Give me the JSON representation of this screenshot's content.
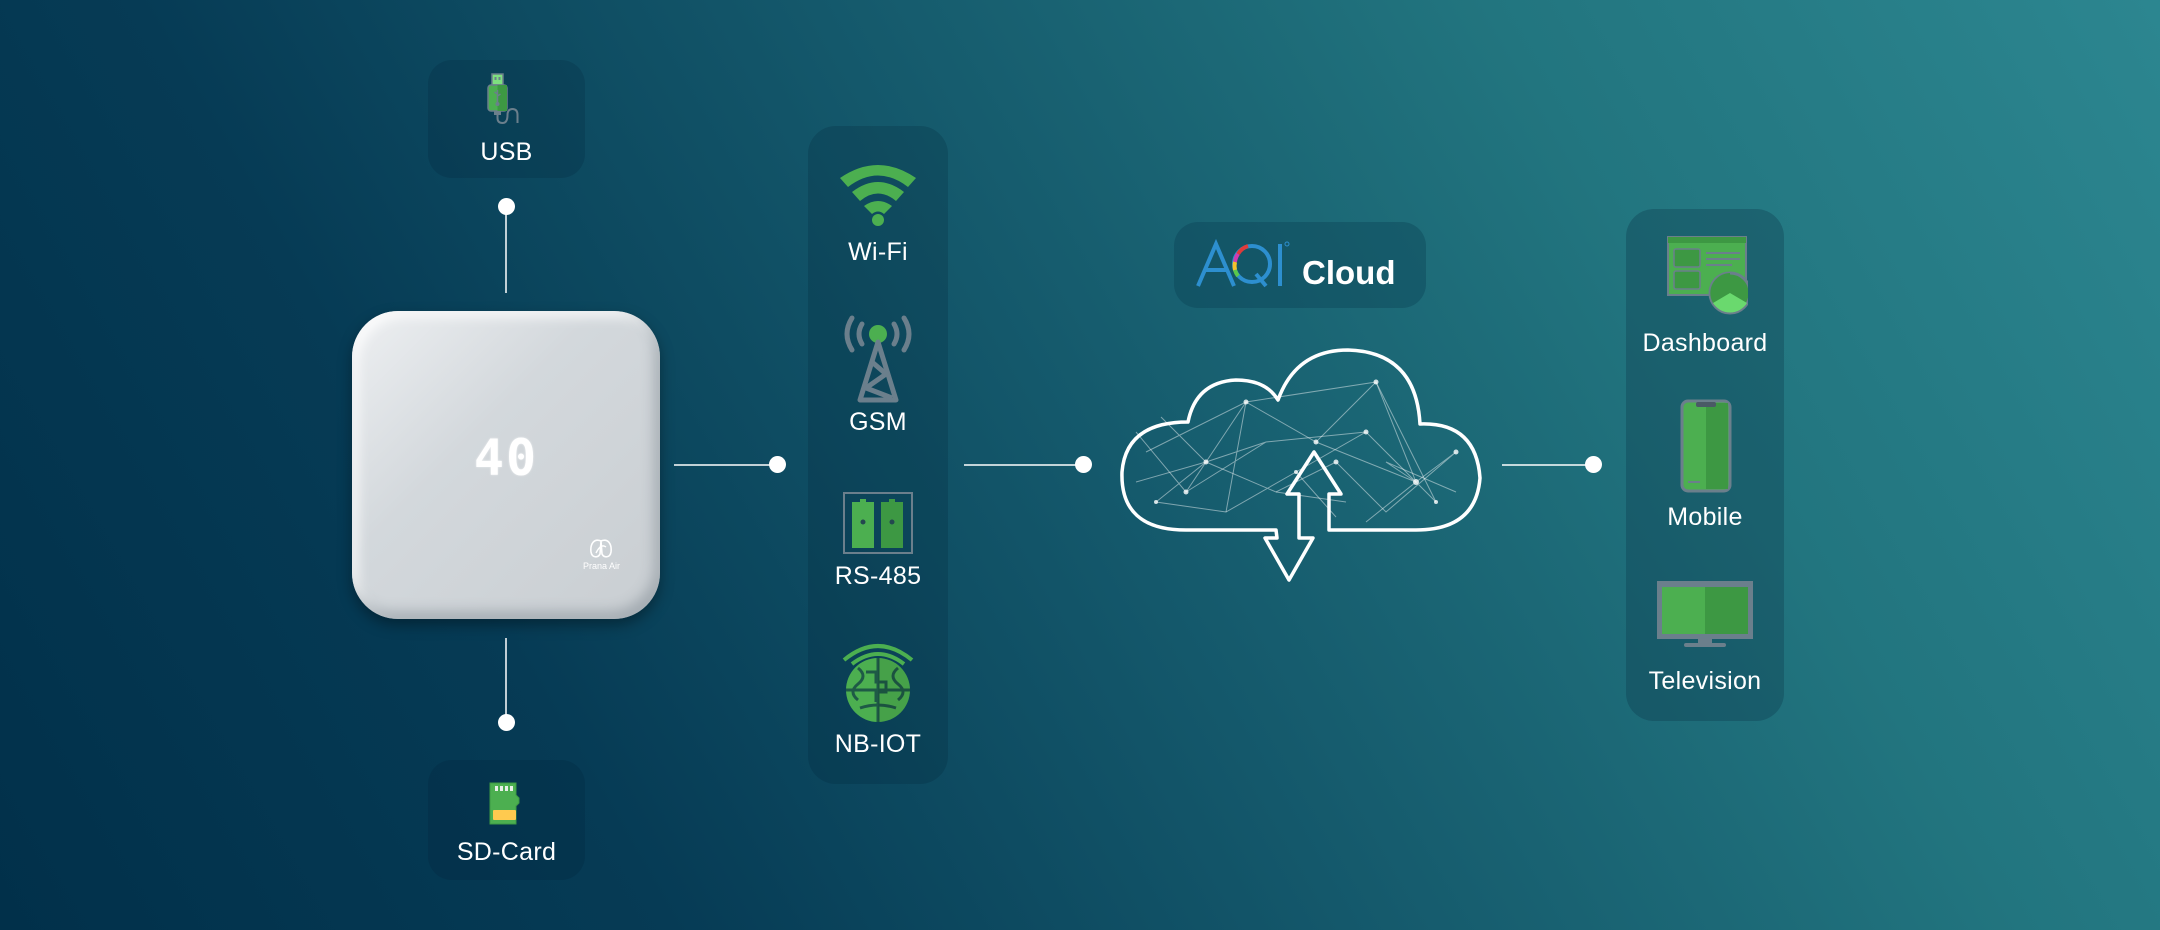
{
  "device": {
    "reading": "40",
    "brand": "Prana Air"
  },
  "storage": {
    "top": {
      "label": "USB",
      "icon": "usb-icon"
    },
    "bottom": {
      "label": "SD-Card",
      "icon": "sd-card-icon"
    }
  },
  "connectivity": [
    {
      "label": "Wi-Fi",
      "icon": "wifi-icon"
    },
    {
      "label": "GSM",
      "icon": "cell-tower-icon"
    },
    {
      "label": "RS-485",
      "icon": "rs485-connector-icon"
    },
    {
      "label": "NB-IOT",
      "icon": "nb-iot-globe-icon"
    }
  ],
  "cloud": {
    "logo_text": "AQI",
    "label": "Cloud",
    "icon": "cloud-upload-download-icon"
  },
  "outputs": [
    {
      "label": "Dashboard",
      "icon": "dashboard-icon"
    },
    {
      "label": "Mobile",
      "icon": "mobile-icon"
    },
    {
      "label": "Television",
      "icon": "television-icon"
    }
  ],
  "colors": {
    "accent_green": "#4caf50",
    "accent_green_dark": "#3d9843",
    "icon_gray": "#6b7f8c",
    "background_start": "#01304a",
    "background_end": "#2c8690"
  }
}
